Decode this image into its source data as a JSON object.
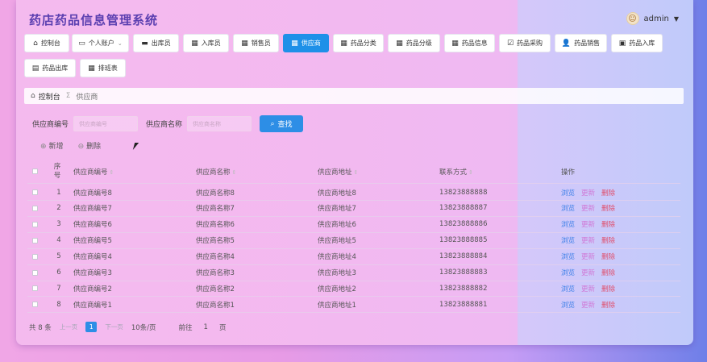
{
  "app": {
    "title": "药店药品信息管理系统",
    "user": "admin"
  },
  "menu": [
    {
      "label": "控制台",
      "icon": "home-icon"
    },
    {
      "label": "个人账户",
      "icon": "account-icon",
      "dropdown": true
    },
    {
      "label": "出库员",
      "icon": "monitor-icon"
    },
    {
      "label": "入库员",
      "icon": "grid-icon"
    },
    {
      "label": "销售员",
      "icon": "grid-icon"
    },
    {
      "label": "供应商",
      "icon": "grid-icon",
      "active": true
    },
    {
      "label": "药品分类",
      "icon": "grid-icon"
    },
    {
      "label": "药品分级",
      "icon": "grid-icon"
    },
    {
      "label": "药品信息",
      "icon": "grid-icon"
    },
    {
      "label": "药品采购",
      "icon": "check-icon"
    },
    {
      "label": "药品销售",
      "icon": "person-icon"
    },
    {
      "label": "药品入库",
      "icon": "box-icon"
    },
    {
      "label": "药品出库",
      "icon": "box-out-icon"
    },
    {
      "label": "排班表",
      "icon": "grid-icon"
    }
  ],
  "breadcrumb": {
    "home": "控制台",
    "current": "供应商"
  },
  "search": {
    "code_label": "供应商编号",
    "code_placeholder": "供应商编号",
    "name_label": "供应商名称",
    "name_placeholder": "供应商名称",
    "button": "查找"
  },
  "actions": {
    "add": "新增",
    "delete": "删除"
  },
  "table": {
    "headers": {
      "index": "序号",
      "code": "供应商编号",
      "name": "供应商名称",
      "address": "供应商地址",
      "phone": "联系方式",
      "ops": "操作"
    },
    "ops": {
      "view": "浏览",
      "edit": "更新",
      "delete": "删除"
    },
    "rows": [
      {
        "index": "1",
        "code": "供应商编号8",
        "name": "供应商名称8",
        "address": "供应商地址8",
        "phone": "13823888888"
      },
      {
        "index": "2",
        "code": "供应商编号7",
        "name": "供应商名称7",
        "address": "供应商地址7",
        "phone": "13823888887"
      },
      {
        "index": "3",
        "code": "供应商编号6",
        "name": "供应商名称6",
        "address": "供应商地址6",
        "phone": "13823888886"
      },
      {
        "index": "4",
        "code": "供应商编号5",
        "name": "供应商名称5",
        "address": "供应商地址5",
        "phone": "13823888885"
      },
      {
        "index": "5",
        "code": "供应商编号4",
        "name": "供应商名称4",
        "address": "供应商地址4",
        "phone": "13823888884"
      },
      {
        "index": "6",
        "code": "供应商编号3",
        "name": "供应商名称3",
        "address": "供应商地址3",
        "phone": "13823888883"
      },
      {
        "index": "7",
        "code": "供应商编号2",
        "name": "供应商名称2",
        "address": "供应商地址2",
        "phone": "13823888882"
      },
      {
        "index": "8",
        "code": "供应商编号1",
        "name": "供应商名称1",
        "address": "供应商地址1",
        "phone": "13823888881"
      }
    ]
  },
  "pager": {
    "total": "共 8 条",
    "prev": "上一页",
    "page": "1",
    "next": "下一页",
    "size": "10条/页",
    "goto": "前往",
    "goto_value": "1",
    "page_unit": "页"
  }
}
